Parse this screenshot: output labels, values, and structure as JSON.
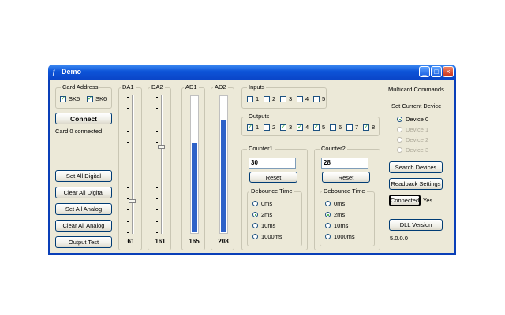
{
  "window": {
    "title": "Demo",
    "buttons": [
      "_",
      "□",
      "×"
    ]
  },
  "card_address": {
    "label": "Card Address",
    "sk5": "SK5",
    "sk6": "SK6",
    "sk5_checked": true,
    "sk6_checked": true
  },
  "connect_label": "Connect",
  "status_text": "Card 0 connected",
  "left_buttons": [
    "Set All Digital",
    "Clear All Digital",
    "Set All Analog",
    "Clear All Analog",
    "Output Test"
  ],
  "da1": {
    "label": "DA1",
    "value": "61",
    "level": 61,
    "max": 255
  },
  "da2": {
    "label": "DA2",
    "value": "161",
    "level": 161,
    "max": 255
  },
  "ad1": {
    "label": "AD1",
    "value": "165",
    "level": 165,
    "max": 255
  },
  "ad2": {
    "label": "AD2",
    "value": "208",
    "level": 208,
    "max": 255
  },
  "inputs": {
    "label": "Inputs",
    "items": [
      "1",
      "2",
      "3",
      "4",
      "5"
    ]
  },
  "outputs": {
    "label": "Outputs",
    "items": [
      "1",
      "2",
      "3",
      "4",
      "5",
      "6",
      "7",
      "8"
    ],
    "checked": [
      true,
      false,
      true,
      true,
      true,
      false,
      false,
      true
    ]
  },
  "counter1": {
    "label": "Counter1",
    "value": "30",
    "reset": "Reset",
    "debounce_label": "Debounce Time",
    "options": [
      "0ms",
      "2ms",
      "10ms",
      "1000ms"
    ],
    "selected": 1
  },
  "counter2": {
    "label": "Counter2",
    "value": "28",
    "reset": "Reset",
    "debounce_label": "Debounce Time",
    "options": [
      "0ms",
      "2ms",
      "10ms",
      "1000ms"
    ],
    "selected": 1
  },
  "multicard": {
    "label": "Multicard Commands",
    "set_current_label": "Set Current Device",
    "devices": [
      "Device 0",
      "Device 1",
      "Device 2",
      "Device 3"
    ],
    "search_label": "Search Devices",
    "readback_label": "Readback Settings",
    "connected_label": "Connected",
    "connected_value": "Yes",
    "dll_label": "DLL Version",
    "dll_version": "5.0.0.0"
  },
  "colors": {
    "bar": "#2e62c8",
    "title_bar": "#0d54d8",
    "face": "#ece9d8"
  }
}
